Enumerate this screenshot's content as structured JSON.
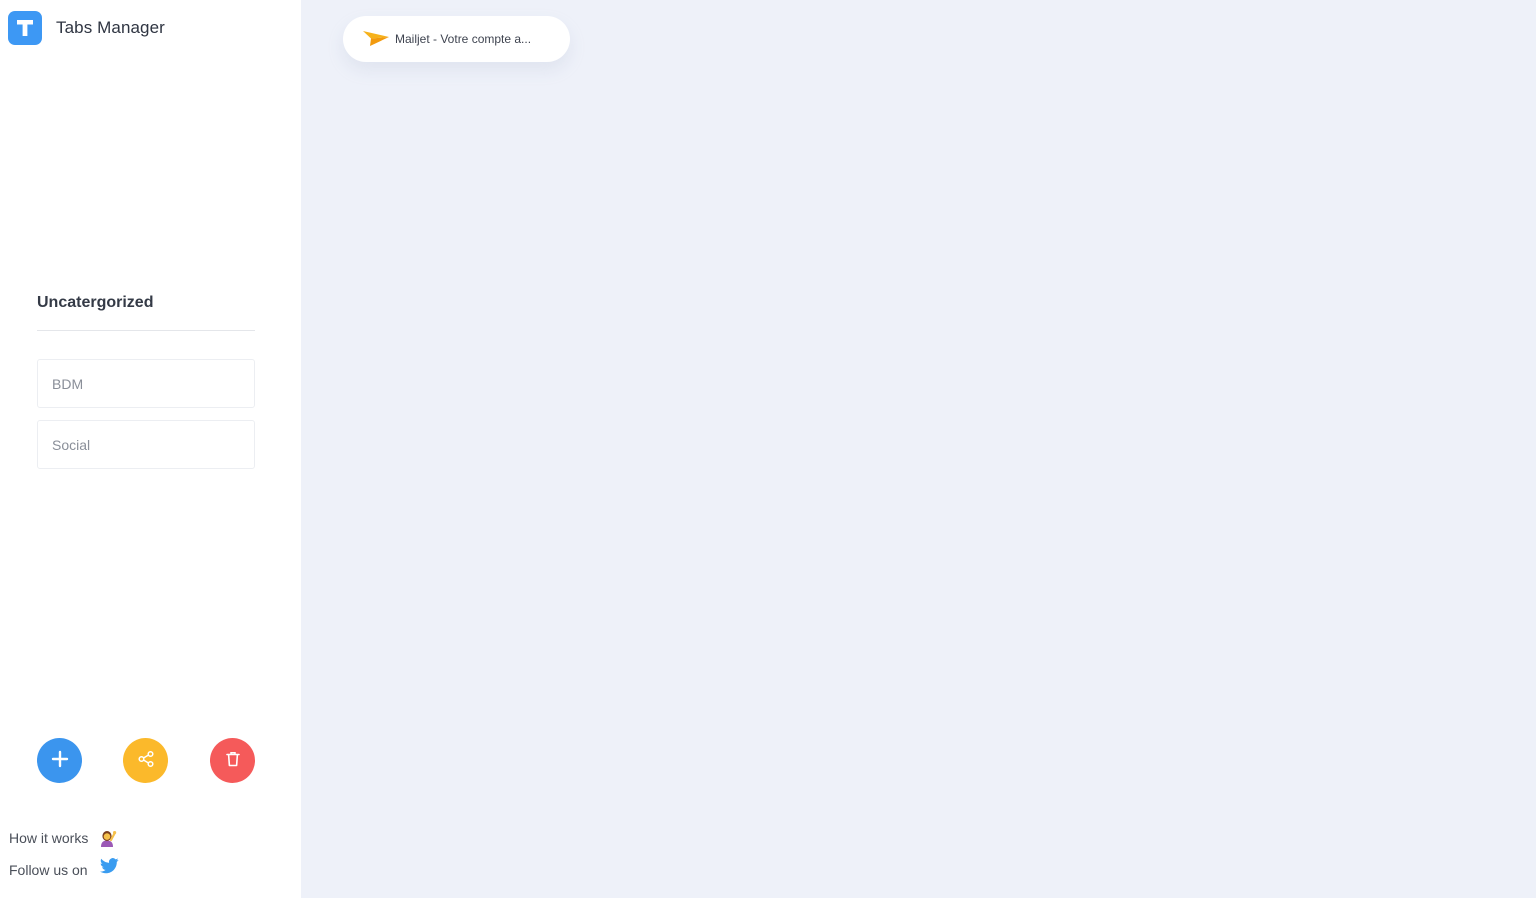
{
  "app": {
    "title": "Tabs Manager",
    "logo_letter": "T",
    "accent_color": "#3d98f4"
  },
  "sidebar": {
    "category": {
      "title": "Uncatergorized",
      "groups": [
        {
          "label": "BDM"
        },
        {
          "label": "Social"
        }
      ]
    },
    "actions": {
      "add_icon": "plus-icon",
      "share_icon": "share-icon",
      "trash_icon": "trash-icon",
      "colors": {
        "add": "#3b95ee",
        "share": "#fbb92b",
        "trash": "#f55a5a"
      }
    },
    "footer": {
      "how_it_works": "How it works",
      "how_it_works_icon": "person-raising-hand-emoji-icon",
      "follow_us": "Follow us on",
      "follow_us_icon": "twitter-bird-icon"
    }
  },
  "main": {
    "tabs": [
      {
        "title": "Mailjet - Votre compte a...",
        "favicon": "mailjet-paper-plane-icon"
      }
    ]
  }
}
